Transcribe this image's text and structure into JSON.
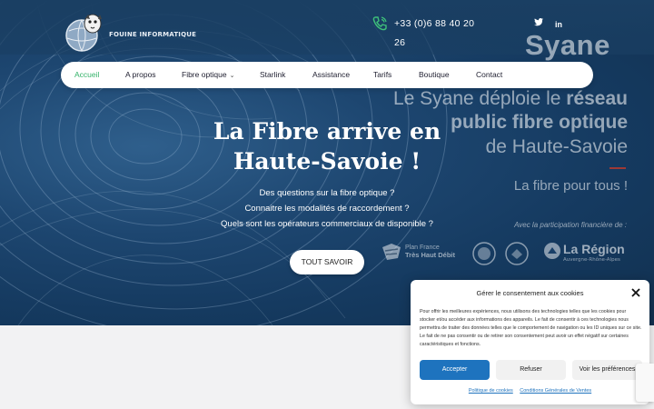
{
  "site": {
    "logo_text": "FOUINE INFORMATIQUE",
    "phone": "+33 (0)6 88 40 20 26",
    "socials": [
      "facebook-icon",
      "twitter-icon",
      "linkedin-icon"
    ],
    "social_glyphs": [
      "",
      "🐦",
      "in"
    ]
  },
  "nav": {
    "items": [
      {
        "label": "Accueil",
        "active": true
      },
      {
        "label": "A propos"
      },
      {
        "label": "Fibre optique",
        "has_dropdown": true
      },
      {
        "label": "Starlink"
      },
      {
        "label": "Assistance"
      },
      {
        "label": "Tarifs"
      },
      {
        "label": "Boutique"
      },
      {
        "label": "Contact"
      }
    ],
    "active_color": "#35b36a"
  },
  "banner": {
    "brand": "Syane",
    "line1_a": "Le Syane déploie le ",
    "line1_b": "réseau",
    "line2": "public fibre optique",
    "line3": "de Haute-Savoie",
    "line4": "La fibre pour tous !",
    "participation": "Avec la participation financière de :",
    "plan_france_1": "Plan France",
    "plan_france_2": "Très Haut Débit",
    "region_title": "La Région",
    "region_sub": "Auvergne-Rhône-Alpes"
  },
  "hero": {
    "title_line1": "La Fibre arrive en",
    "title_line2": "Haute-Savoie !",
    "q1": "Des questions sur la fibre optique ?",
    "q2": "Connaitre les modalités de raccordement ?",
    "q3": "Quels sont les opérateurs commerciaux de disponible ?",
    "cta": "TOUT SAVOIR"
  },
  "cookie": {
    "title": "Gérer le consentement aux cookies",
    "body": "Pour offrir les meilleures expériences, nous utilisons des technologies telles que les cookies pour stocker et/ou accéder aux informations des appareils. Le fait de consentir à ces technologies nous permettra de traiter des données telles que le comportement de navigation ou les ID uniques sur ce site. Le fait de ne pas consentir ou de retirer son consentement peut avoir un effet négatif sur certaines caractéristiques et fonctions.",
    "accept": "Accepter",
    "refuse": "Refuser",
    "prefs": "Voir les préférences",
    "link_cookies": "Politique de cookies",
    "link_cgv": "Conditions Générales de Ventes",
    "accent": "#1e73be"
  }
}
